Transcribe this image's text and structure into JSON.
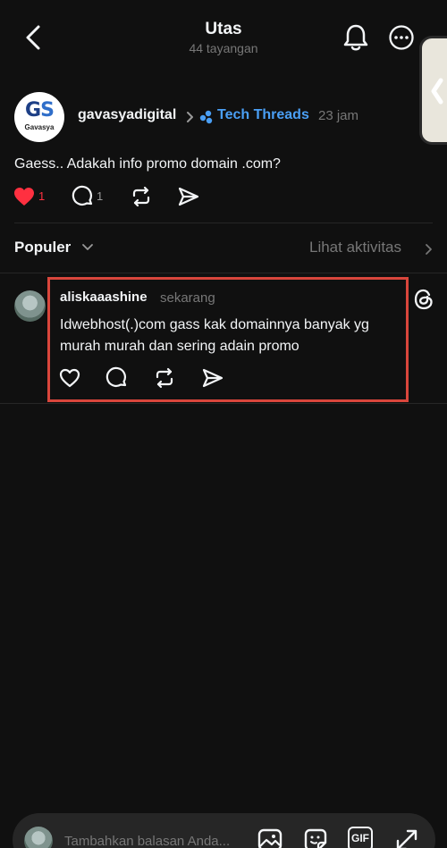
{
  "header": {
    "title": "Utas",
    "subtitle": "44 tayangan",
    "back_icon": "chevron-left-icon",
    "bell_icon": "bell-icon",
    "more_icon": "more-horizontal-icon"
  },
  "post": {
    "avatar_logo_text": "GS",
    "avatar_logo_sub": "Gavasya",
    "username": "gavasyadigital",
    "community": "Tech Threads",
    "time": "23 jam",
    "text": "Gaess.. Adakah info promo domain .com?",
    "likes": "1",
    "replies": "1",
    "liked": true
  },
  "replies_section": {
    "sort_label": "Populer",
    "activity_link": "Lihat aktivitas"
  },
  "reply": {
    "username": "aliskaaashine",
    "time": "sekarang",
    "text": "Idwebhost(.)com gass kak domainnya banyak yg murah murah dan sering adain promo"
  },
  "composer": {
    "placeholder": "Tambahkan balasan Anda...",
    "gif_label": "GIF"
  },
  "colors": {
    "background": "#101010",
    "accent_link": "#4a9ff5",
    "like_red": "#ff3040",
    "highlight": "#d9463c"
  }
}
